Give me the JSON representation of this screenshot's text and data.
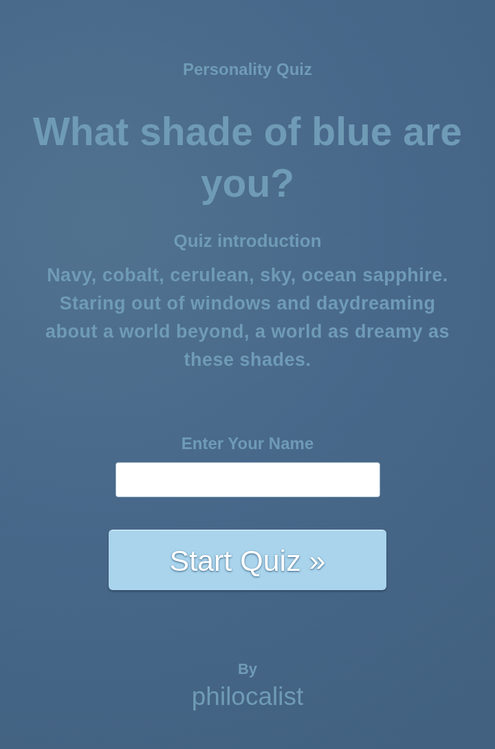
{
  "header": {
    "eyebrow": "Personality Quiz",
    "title": "What shade of blue are you?"
  },
  "introduction": {
    "heading": "Quiz introduction",
    "text": "Navy, cobalt, cerulean, sky, ocean sapphire. Staring out of windows and daydreaming about a world beyond, a world as dreamy as these shades."
  },
  "name_field": {
    "label": "Enter Your Name"
  },
  "start_button": {
    "label": "Start Quiz »",
    "disabled": true
  },
  "author": {
    "prefix": "By",
    "name": "philocalist"
  }
}
